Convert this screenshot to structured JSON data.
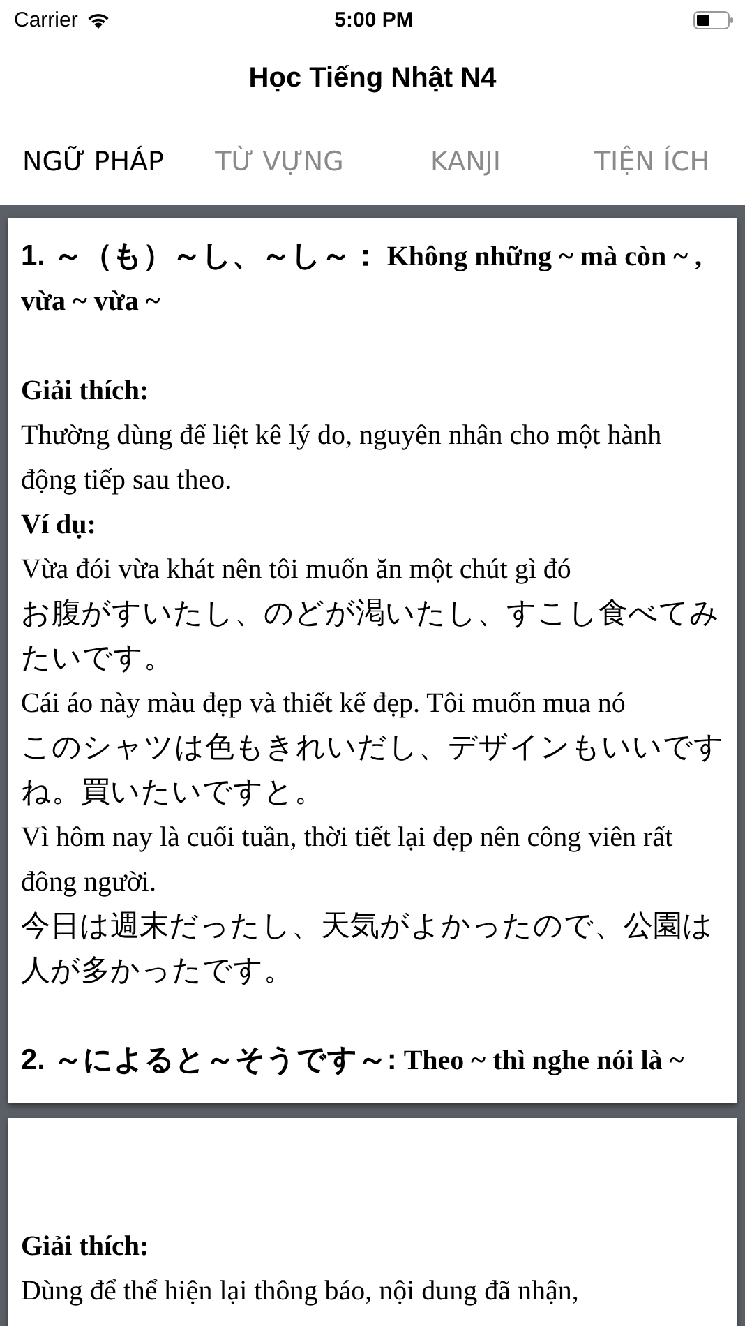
{
  "status_bar": {
    "carrier": "Carrier",
    "time": "5:00 PM"
  },
  "title": "Học Tiếng Nhật N4",
  "tabs": [
    {
      "label": "NGỮ PHÁP",
      "selected": true
    },
    {
      "label": "TỪ VỰNG",
      "selected": false
    },
    {
      "label": "KANJI",
      "selected": false
    },
    {
      "label": "TIỆN ÍCH",
      "selected": false
    }
  ],
  "cards": [
    {
      "blocks": [
        {
          "kind": "heading",
          "pattern": "1. ～（も）～し、～し～：",
          "meaning": "Không những ~ mà còn ~ , vừa ~ vừa ~"
        },
        {
          "kind": "gap"
        },
        {
          "kind": "label",
          "text": "Giải thích:"
        },
        {
          "kind": "vi",
          "text": "Thường dùng để liệt kê lý do, nguyên nhân cho một hành động tiếp sau theo."
        },
        {
          "kind": "label",
          "text": "Ví dụ:"
        },
        {
          "kind": "vi",
          "text": "Vừa đói vừa khát nên tôi muốn ăn một chút gì đó"
        },
        {
          "kind": "ja",
          "text": "お腹がすいたし、のどが渇いたし、すこし食べてみたいです。"
        },
        {
          "kind": "vi",
          "text": "Cái áo này màu đẹp và thiết kế đẹp. Tôi muốn mua nó"
        },
        {
          "kind": "ja",
          "text": "このシャツは色もきれいだし、デザインもいいですね。買いたいですと。"
        },
        {
          "kind": "vi",
          "text": "Vì hôm nay là cuối tuần, thời tiết lại đẹp nên công viên rất đông người."
        },
        {
          "kind": "ja",
          "text": "今日は週末だったし、天気がよかったので、公園は人が多かったです。"
        },
        {
          "kind": "gap"
        },
        {
          "kind": "heading",
          "pattern": "2. ～によると～そうです～:",
          "meaning": "Theo ~ thì nghe nói là ~"
        }
      ]
    },
    {
      "blocks": [
        {
          "kind": "gap"
        },
        {
          "kind": "gap"
        },
        {
          "kind": "label",
          "text": "Giải thích:"
        },
        {
          "kind": "vi",
          "text": "Dùng để thể hiện lại thông báo, nội dung đã nhận,"
        }
      ]
    }
  ]
}
